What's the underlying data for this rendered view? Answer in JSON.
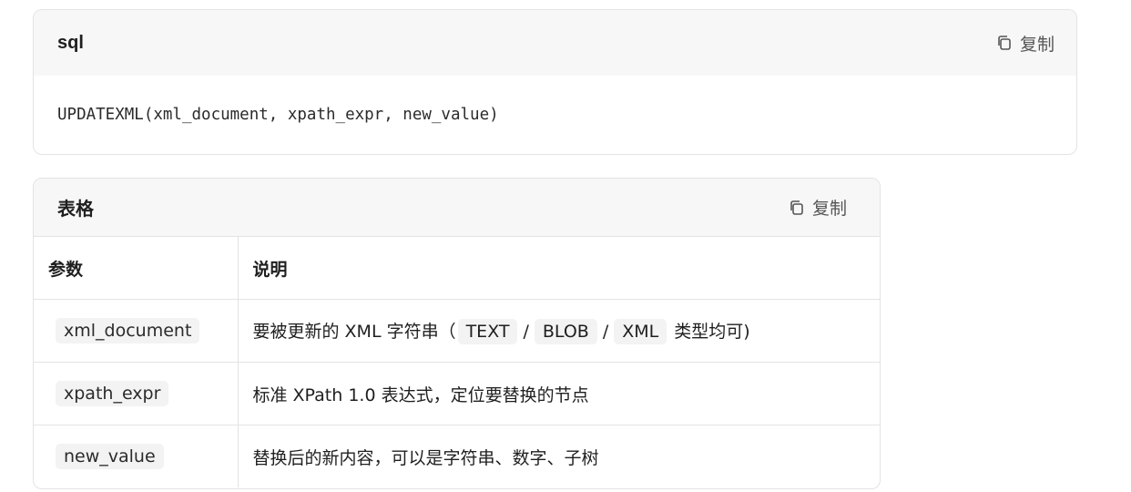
{
  "code_block": {
    "language": "sql",
    "copy_label": "复制",
    "code": "UPDATEXML(xml_document, xpath_expr, new_value)"
  },
  "table_block": {
    "title": "表格",
    "copy_label": "复制",
    "headers": [
      "参数",
      "说明"
    ],
    "rows": [
      {
        "param": "xml_document",
        "desc_prefix": "要被更新的 XML 字符串（",
        "desc_chips": [
          "TEXT",
          "BLOB",
          "XML"
        ],
        "desc_separator": "/",
        "desc_suffix": "类型均可)"
      },
      {
        "param": "xpath_expr",
        "desc": "标准 XPath 1.0 表达式，定位要替换的节点"
      },
      {
        "param": "new_value",
        "desc": "替换后的新内容，可以是字符串、数字、子树"
      }
    ]
  },
  "icons": {
    "copy": "copy-icon"
  }
}
